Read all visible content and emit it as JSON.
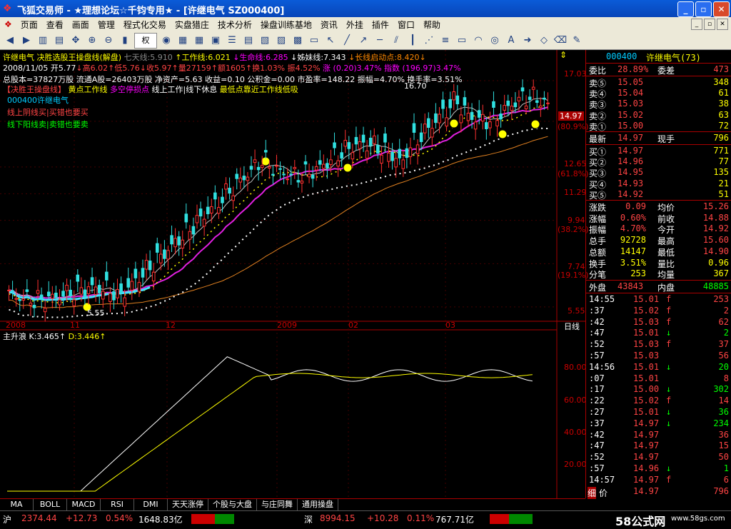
{
  "window": {
    "title": "飞狐交易师 - ★理想论坛☆千钧专用★ - [许继电气 SZ000400]",
    "app_icon": "fox-logo-icon",
    "buttons": [
      "_",
      "▫",
      "✕"
    ]
  },
  "menu": [
    "页面",
    "查看",
    "画面",
    "管理",
    "程式化交易",
    "实盘猎庄",
    "技术分析",
    "操盘训练基地",
    "资讯",
    "外挂",
    "插件",
    "窗口",
    "帮助"
  ],
  "toolbar": {
    "select_label": "权"
  },
  "info": {
    "line1a": "许继电气  决胜选股王操盘线(解盘)",
    "line1b": "七天线:5.910",
    "line1c": "↑工作线:6.021",
    "line1d": "↓生命线:6.285",
    "line1e": "↓姊妹线:7.343",
    "line1f": "↓长线启动点:8.420↓",
    "line2a": "2008/11/05 开5.77",
    "line2b": "↓高6.02↑低5.76↓收5.97↑量27159↑额1605↑换1.03% 振4.52% ",
    "line2c": "涨 (0.20)3.47% 指数 (196.97)3.47%",
    "line3": "总股本=37827万股 流通A股=26403万股 净资产=5.63 收益=0.10 公积金=0.00 市盈率=148.22 振幅=4.70% 换手率=3.51%",
    "legend_a": "【决胜王操盘线】",
    "legend_b": "黄点工作线",
    "legend_c": "多空停损点",
    "legend_d": "线上工作|线下休息",
    "legend_e": "最低点靠近工作线低吸",
    "code_label": "000400许继电气",
    "hint1": "线上阴线买|买错也要买",
    "hint2": "线下阳线卖|卖错也要卖",
    "high_mark": "16.70",
    "low_mark": "5.55"
  },
  "chart_data": [
    {
      "type": "candlestick",
      "title": "",
      "y_ticks": [
        "17.03",
        "14.97",
        "12.65",
        "11.29",
        "9.94",
        "7.74",
        "5.55"
      ],
      "pct_ticks": [
        "(80.9%)",
        "(61.8%)",
        "(38.2%)",
        "(19.1%)"
      ],
      "x_ticks": [
        "2008",
        "11",
        "12",
        "2009",
        "02",
        "03"
      ],
      "x_label": "日线",
      "ylim": [
        5.0,
        17.5
      ],
      "last_price": "14.97"
    },
    {
      "type": "line",
      "title": "主升浪",
      "k_label": "K:3.465↑",
      "d_label": "D:3.446↑",
      "y_ticks": [
        "80.00",
        "60.00",
        "40.00",
        "20.00"
      ],
      "ylim": [
        0,
        100
      ]
    }
  ],
  "quote": {
    "code": "000400",
    "name": "许继电气(73)",
    "weibi_label": "委比",
    "weibi": "28.89%",
    "weicha_label": "委差",
    "weicha": "473",
    "sells": [
      {
        "label": "卖⑤",
        "price": "15.05",
        "vol": "348"
      },
      {
        "label": "卖④",
        "price": "15.04",
        "vol": "61"
      },
      {
        "label": "卖③",
        "price": "15.03",
        "vol": "38"
      },
      {
        "label": "卖②",
        "price": "15.02",
        "vol": "63"
      },
      {
        "label": "卖①",
        "price": "15.00",
        "vol": "72"
      }
    ],
    "latest_label": "最新",
    "latest": "14.97",
    "xianshou_label": "现手",
    "xianshou": "796",
    "buys": [
      {
        "label": "买①",
        "price": "14.97",
        "vol": "771"
      },
      {
        "label": "买②",
        "price": "14.96",
        "vol": "77"
      },
      {
        "label": "买③",
        "price": "14.95",
        "vol": "135"
      },
      {
        "label": "买④",
        "price": "14.93",
        "vol": "21"
      },
      {
        "label": "买⑤",
        "price": "14.92",
        "vol": "51"
      }
    ],
    "stats": [
      {
        "l1": "涨跌",
        "v1": "0.09",
        "l2": "均价",
        "v2": "15.26"
      },
      {
        "l1": "涨幅",
        "v1": "0.60%",
        "l2": "前收",
        "v2": "14.88"
      },
      {
        "l1": "振幅",
        "v1": "4.70%",
        "l2": "今开",
        "v2": "14.92"
      },
      {
        "l1": "总手",
        "v1": "92728",
        "l2": "最高",
        "v2": "15.60"
      },
      {
        "l1": "总额",
        "v1": "14147",
        "l2": "最低",
        "v2": "14.90"
      },
      {
        "l1": "换手",
        "v1": "3.51%",
        "l2": "量比",
        "v2": "0.96"
      },
      {
        "l1": "分笔",
        "v1": "253",
        "l2": "均量",
        "v2": "367"
      }
    ],
    "waipan_label": "外盘",
    "waipan": "43843",
    "neipan_label": "内盘",
    "neipan": "48885",
    "ticks": [
      {
        "t": "14:55",
        "p": "15.01",
        "f": "f",
        "v": "253"
      },
      {
        "t": ":37",
        "p": "15.02",
        "f": "f",
        "v": "2"
      },
      {
        "t": ":42",
        "p": "15.03",
        "f": "f",
        "v": "62"
      },
      {
        "t": ":47",
        "p": "15.01",
        "f": "↓",
        "v": "2"
      },
      {
        "t": ":52",
        "p": "15.03",
        "f": "f",
        "v": "37"
      },
      {
        "t": ":57",
        "p": "15.03",
        "f": "",
        "v": "56"
      },
      {
        "t": "14:56",
        "p": "15.01",
        "f": "↓",
        "v": "20"
      },
      {
        "t": ":07",
        "p": "15.01",
        "f": "",
        "v": "8"
      },
      {
        "t": ":17",
        "p": "15.00",
        "f": "↓",
        "v": "302"
      },
      {
        "t": ":22",
        "p": "15.02",
        "f": "f",
        "v": "14"
      },
      {
        "t": ":27",
        "p": "15.01",
        "f": "↓",
        "v": "36"
      },
      {
        "t": ":37",
        "p": "14.97",
        "f": "↓",
        "v": "234"
      },
      {
        "t": ":42",
        "p": "14.97",
        "f": "",
        "v": "36"
      },
      {
        "t": ":47",
        "p": "14.97",
        "f": "",
        "v": "15"
      },
      {
        "t": ":52",
        "p": "14.97",
        "f": "",
        "v": "50"
      },
      {
        "t": ":57",
        "p": "14.96",
        "f": "↓",
        "v": "1"
      },
      {
        "t": "14:57",
        "p": "14.97",
        "f": "f",
        "v": "6"
      },
      {
        "t": "15:00",
        "p": "14.97",
        "f": "",
        "v": "796"
      }
    ],
    "tab_a": "细",
    "tab_b": "价"
  },
  "bottom_tabs": [
    "MA",
    "BOLL",
    "MACD",
    "RSI",
    "DMI",
    "天天涨停",
    "个股与大盘",
    "与庄同舞",
    "通用操盘"
  ],
  "status": {
    "sh_label": "沪",
    "sh_index": "2374.44",
    "sh_chg": "+12.73",
    "sh_pct": "0.54%",
    "sh_amt": "1648.83亿",
    "sz_label": "深",
    "sz_index": "8994.15",
    "sz_chg": "+10.28",
    "sz_pct": "0.11%",
    "sz_amt": "767.71亿",
    "watermark": "58公式网",
    "watermark_url": "www.58gs.com"
  }
}
